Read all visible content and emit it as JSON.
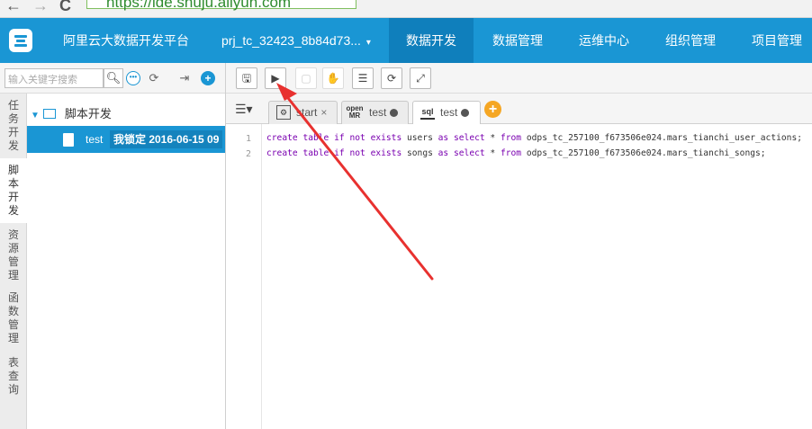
{
  "browser": {
    "back_glyph": "←",
    "forward_glyph": "→",
    "reload_glyph": "C",
    "url": "https://ide.shuju.aliyun.com"
  },
  "nav": {
    "brand": "阿里云大数据开发平台",
    "project": "prj_tc_32423_8b84d73...",
    "caret": "▾",
    "menus": [
      "数据开发",
      "数据管理",
      "运维中心",
      "组织管理",
      "项目管理"
    ],
    "active_menu_index": 0
  },
  "toolbar": {
    "search_placeholder": "输入关键字搜索",
    "icons": {
      "search": "search-icon",
      "dots": "more-icon",
      "refresh": "refresh-icon",
      "import": "import-icon",
      "add": "add-icon"
    },
    "editor_buttons": [
      "save-icon",
      "run-icon",
      "stop-icon",
      "submit-icon",
      "format-icon",
      "refresh-icon",
      "fullscreen-icon"
    ]
  },
  "sidebar": {
    "tabs": [
      "任务开发",
      "脚本开发",
      "资源管理",
      "函数管理",
      "表查询"
    ],
    "active_tab_index": 1,
    "tree": {
      "folder": "脚本开发",
      "file_name": "test",
      "file_lock": "我锁定 2016-06-15 09"
    }
  },
  "editor": {
    "tabs": [
      {
        "icon": "start-node-icon",
        "label": "start",
        "suffix": "×",
        "active": false
      },
      {
        "icon": "open-mr-icon",
        "icon_text": "open MR",
        "label": "test",
        "suffix": "●",
        "active": false
      },
      {
        "icon": "sql-file-icon",
        "icon_text": "sql",
        "label": "test",
        "suffix": "●",
        "active": true
      }
    ],
    "add_tab_glyph": "+",
    "lines": [
      {
        "no": "1",
        "text": "create table if not exists users as select * from odps_tc_257100_f673506e024.mars_tianchi_user_actions;"
      },
      {
        "no": "2",
        "text": "create table if not exists songs as select * from odps_tc_257100_f673506e024.mars_tianchi_songs;"
      }
    ]
  },
  "colors": {
    "nav_blue": "#1a96d4",
    "nav_active": "#0f7fbc",
    "annotation_red": "#e8312f",
    "add_orange": "#f5a623"
  }
}
